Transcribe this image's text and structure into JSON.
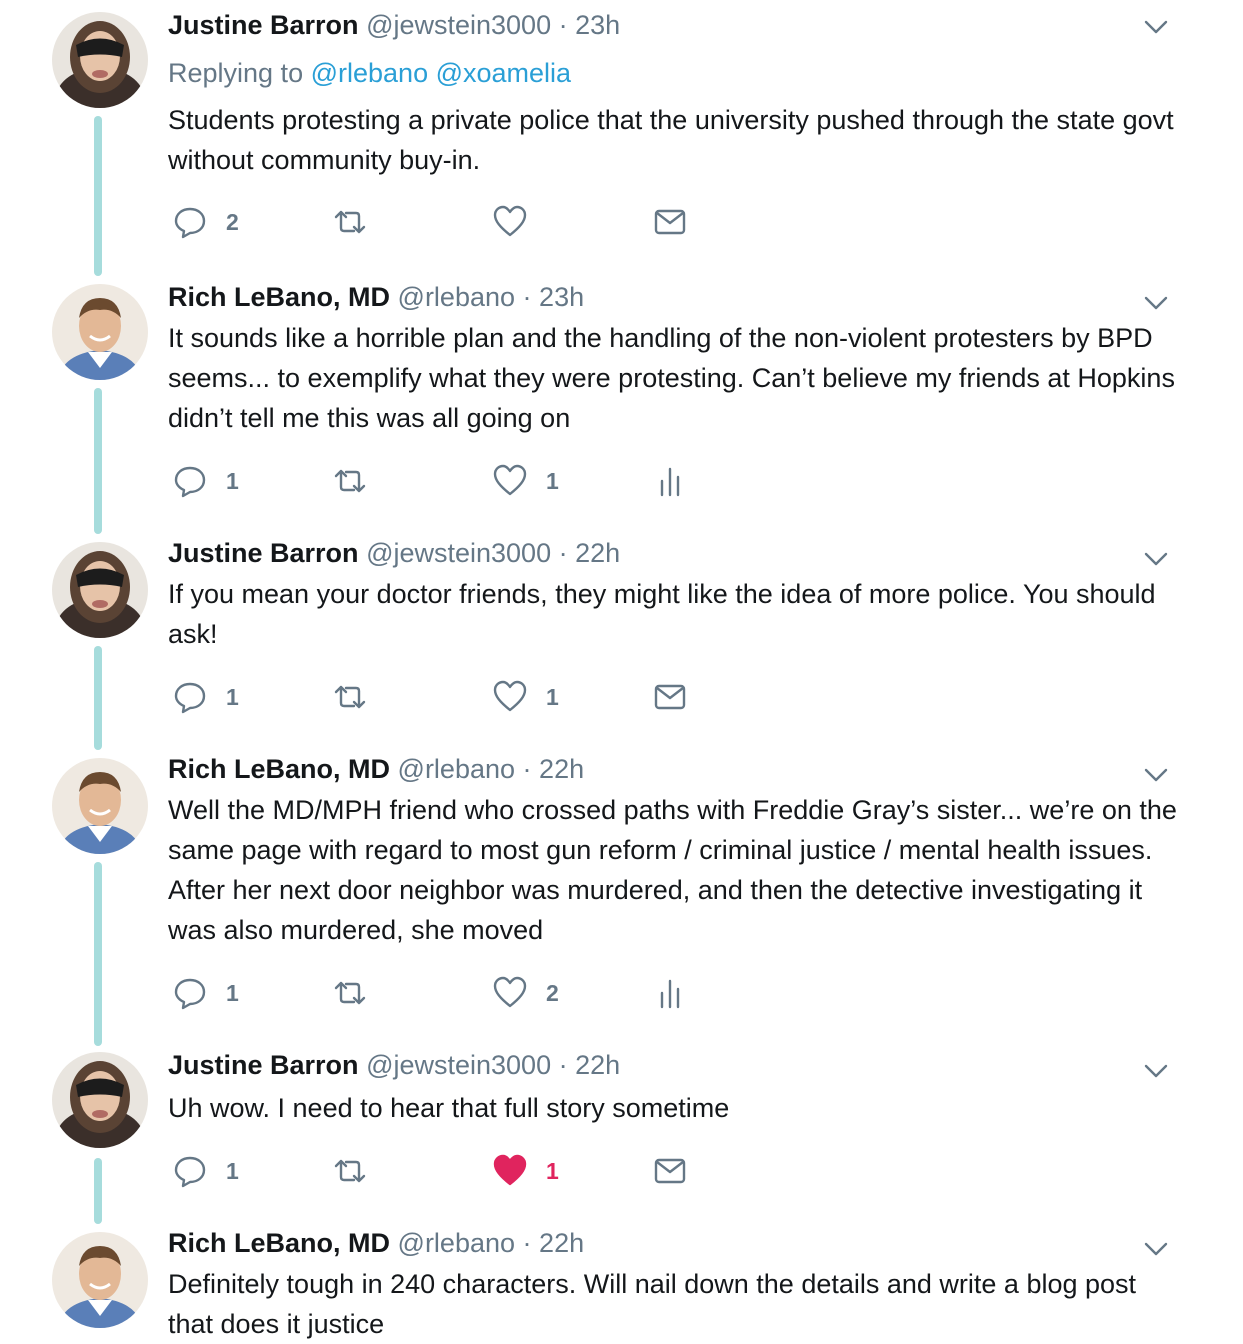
{
  "tweets": [
    {
      "name": "Justine Barron",
      "handle": "@jewstein3000",
      "sep": "·",
      "time": "23h",
      "replying_prefix": "Replying to",
      "replying_mentions": [
        "@rlebano",
        "@xoamelia"
      ],
      "text": "Students protesting a private police that the university pushed through the state govt without community buy-in.",
      "reply_count": "2",
      "retweet_count": "",
      "like_count": "",
      "liked": false,
      "third_action_icon": "envelope-icon"
    },
    {
      "name": "Rich LeBano, MD",
      "handle": "@rlebano",
      "sep": "·",
      "time": "23h",
      "text": "It sounds like a horrible plan and the handling of the non-violent protesters by BPD seems... to exemplify what they were protesting. Can’t believe my friends at Hopkins didn’t tell me this was all going on",
      "reply_count": "1",
      "retweet_count": "",
      "like_count": "1",
      "liked": false,
      "third_action_icon": "analytics-icon"
    },
    {
      "name": "Justine Barron",
      "handle": "@jewstein3000",
      "sep": "·",
      "time": "22h",
      "text": "If you mean your doctor friends, they might like the idea of more police. You should ask!",
      "reply_count": "1",
      "retweet_count": "",
      "like_count": "1",
      "liked": false,
      "third_action_icon": "envelope-icon"
    },
    {
      "name": "Rich LeBano, MD",
      "handle": "@rlebano",
      "sep": "·",
      "time": "22h",
      "text": "Well the MD/MPH friend who crossed paths with Freddie Gray’s sister... we’re on the same page with regard to most gun reform / criminal justice / mental health issues. After her next door neighbor was murdered, and then the detective investigating it was also murdered, she moved",
      "reply_count": "1",
      "retweet_count": "",
      "like_count": "2",
      "liked": false,
      "third_action_icon": "analytics-icon"
    },
    {
      "name": "Justine Barron",
      "handle": "@jewstein3000",
      "sep": "·",
      "time": "22h",
      "text": "Uh wow. I need to hear that full story sometime",
      "reply_count": "1",
      "retweet_count": "",
      "like_count": "1",
      "liked": true,
      "third_action_icon": "envelope-icon"
    },
    {
      "name": "Rich LeBano, MD",
      "handle": "@rlebano",
      "sep": "·",
      "time": "22h",
      "text": "Definitely tough in 240 characters. Will nail down the details and write a blog post that does it justice"
    }
  ],
  "colors": {
    "thread_line": "#a6dcdc",
    "mention": "#2a9fd6",
    "muted": "#657786",
    "like_active": "#e0245e"
  }
}
